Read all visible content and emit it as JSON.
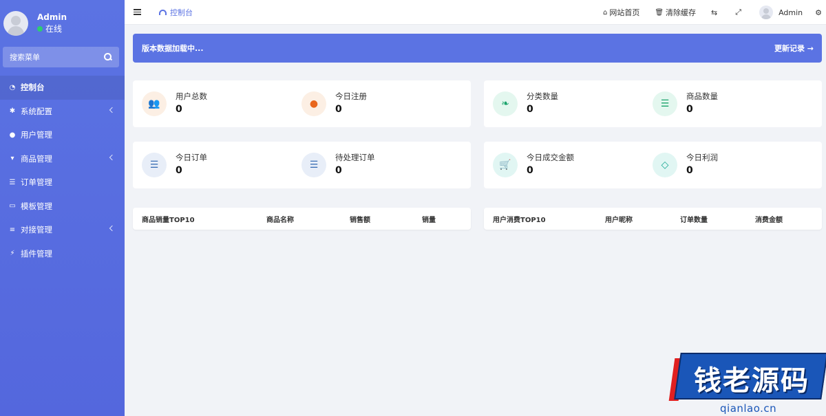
{
  "sidebar": {
    "user_name": "Admin",
    "user_status": "在线",
    "search_placeholder": "搜索菜单",
    "items": [
      {
        "label": "控制台",
        "icon": "gauge-icon",
        "active": true,
        "has_children": false
      },
      {
        "label": "系统配置",
        "icon": "gear-icon",
        "active": false,
        "has_children": true
      },
      {
        "label": "用户管理",
        "icon": "user-icon",
        "active": false,
        "has_children": false
      },
      {
        "label": "商品管理",
        "icon": "cart-icon",
        "active": false,
        "has_children": true
      },
      {
        "label": "订单管理",
        "icon": "list-icon",
        "active": false,
        "has_children": false
      },
      {
        "label": "模板管理",
        "icon": "template-icon",
        "active": false,
        "has_children": false
      },
      {
        "label": "对接管理",
        "icon": "sliders-icon",
        "active": false,
        "has_children": true
      },
      {
        "label": "插件管理",
        "icon": "plug-icon",
        "active": false,
        "has_children": false
      }
    ]
  },
  "topbar": {
    "tab_label": "控制台",
    "home_link": "网站首页",
    "clear_cache": "清除缓存",
    "admin_name": "Admin"
  },
  "banner": {
    "message": "版本数据加载中...",
    "action": "更新记录 →"
  },
  "stats": [
    {
      "label": "用户总数",
      "value": "0",
      "icon": "users-icon"
    },
    {
      "label": "今日注册",
      "value": "0",
      "icon": "user-icon"
    },
    {
      "label": "分类数量",
      "value": "0",
      "icon": "leaf-icon"
    },
    {
      "label": "商品数量",
      "value": "0",
      "icon": "list-icon"
    },
    {
      "label": "今日订单",
      "value": "0",
      "icon": "list-icon"
    },
    {
      "label": "待处理订单",
      "value": "0",
      "icon": "list-icon"
    },
    {
      "label": "今日成交金额",
      "value": "0",
      "icon": "cart-icon"
    },
    {
      "label": "今日利润",
      "value": "0",
      "icon": "diamond-icon"
    }
  ],
  "tables": {
    "goods_top": {
      "headers": [
        "商品销量TOP10",
        "商品名称",
        "销售额",
        "销量"
      ]
    },
    "users_top": {
      "headers": [
        "用户消费TOP10",
        "用户昵称",
        "订单数量",
        "消费金额"
      ]
    }
  },
  "watermark": {
    "brand": "钱老源码",
    "url": "qianlao.cn"
  },
  "colors": {
    "primary": "#5b73e3",
    "background": "#f1f3f7"
  }
}
